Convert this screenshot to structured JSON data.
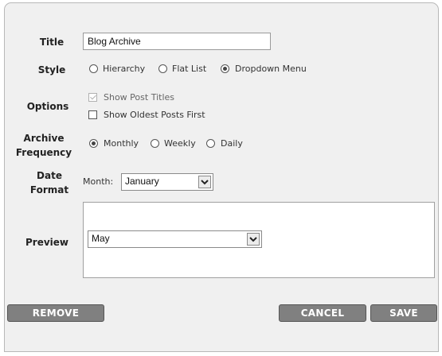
{
  "labels": {
    "title": "Title",
    "style": "Style",
    "options": "Options",
    "archive_frequency_line1": "Archive",
    "archive_frequency_line2": "Frequency",
    "date_format_line1": "Date",
    "date_format_line2": "Format",
    "preview": "Preview"
  },
  "title_field": {
    "value": "Blog Archive"
  },
  "style": {
    "options": [
      "Hierarchy",
      "Flat List",
      "Dropdown Menu"
    ],
    "selected": "Dropdown Menu"
  },
  "options": {
    "show_post_titles": {
      "label": "Show Post Titles",
      "checked": true,
      "disabled": true
    },
    "show_oldest_first": {
      "label": "Show Oldest Posts First",
      "checked": false
    }
  },
  "frequency": {
    "options": [
      "Monthly",
      "Weekly",
      "Daily"
    ],
    "selected": "Monthly"
  },
  "date_format": {
    "prefix": "Month:",
    "value": "January"
  },
  "preview": {
    "dropdown_value": "May"
  },
  "buttons": {
    "remove": "REMOVE",
    "cancel": "CANCEL",
    "save": "SAVE"
  },
  "colors": {
    "panel_bg": "#f0f0f0",
    "button_bg": "#808080",
    "button_text": "#ffffff"
  },
  "icons": {
    "dropdown_arrow": "chevron-down-icon"
  }
}
